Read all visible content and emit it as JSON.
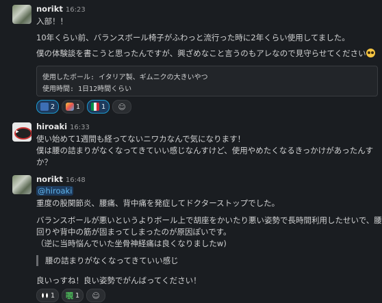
{
  "messages": [
    {
      "user": "norikt",
      "time": "16:23",
      "lines": [
        "入部！！",
        "10年くらい前、バランスボール椅子がふわっと流行った時に2年くらい使用してました。",
        "僕の体験談を書こうと思ったんですが、興ざめなこと言うのもアレなので見守らせてください"
      ],
      "code": [
        "使用したボール: イタリア製、ギムニクの大きいやつ",
        "使用時間: 1日12時間くらい"
      ],
      "reactions": [
        {
          "emoji": "chat-icon",
          "count": "2"
        },
        {
          "emoji": "party-icon",
          "count": "1"
        },
        {
          "emoji": "italy-flag-icon",
          "count": "1"
        }
      ]
    },
    {
      "user": "hiroaki",
      "time": "16:33",
      "lines": [
        "使い始めて1週間も経ってないニワカなんで気になります！",
        "僕は腰の詰まりがなくなってきていい感じなんすけど、使用やめたくなるきっかけがあったんす",
        "か？"
      ]
    },
    {
      "user": "norikt",
      "time": "16:48",
      "mention": "@hiroaki",
      "lines": [
        "重度の股関節炎、腰痛、背中痛を発症してドクターストップでした。",
        "バランスボールが悪いというよりボール上で胡座をかいたり悪い姿勢で長時間利用したせいで、腰",
        "回りや背中の筋が固まってしまったのが原因ぽいです。",
        "（逆に当時悩んでいた坐骨神経痛は良くなりましたw)"
      ],
      "quote": "腰の詰まりがなくなってきていい感じ",
      "after": "良いっすね！良い姿勢でがんばってください！",
      "reactions": [
        {
          "emoji": "eyes-icon",
          "count": "1"
        },
        {
          "emoji": "kanji-icon",
          "label": "覗",
          "count": "1"
        }
      ]
    }
  ]
}
